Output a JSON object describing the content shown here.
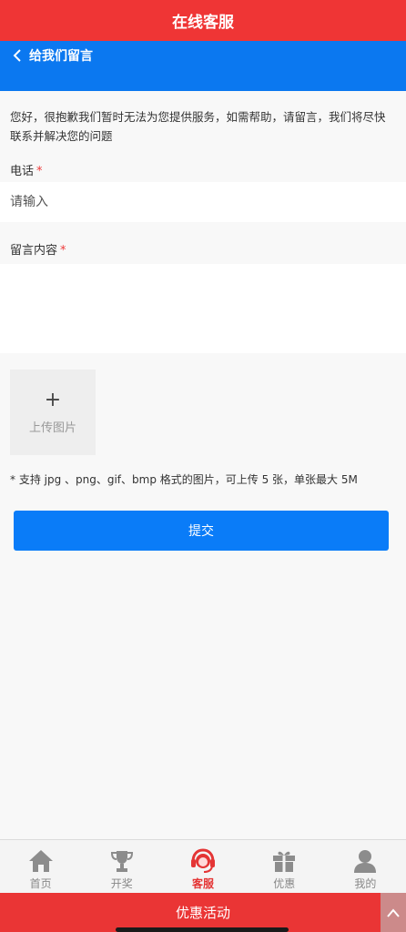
{
  "header": {
    "title": "在线客服"
  },
  "subheader": {
    "back_label": "给我们留言"
  },
  "form": {
    "intro": "您好，很抱歉我们暂时无法为您提供服务，如需帮助，请留言，我们将尽快联系并解决您的问题",
    "phone_label": "电话",
    "phone_placeholder": "请输入",
    "message_label": "留言内容",
    "required_mark": "*",
    "upload_plus": "+",
    "upload_label": "上传图片",
    "upload_hint": "* 支持 jpg 、png、gif、bmp 格式的图片，可上传 5 张，单张最大 5M",
    "submit_label": "提交"
  },
  "tabs": [
    {
      "label": "首页",
      "icon": "home-icon"
    },
    {
      "label": "开奖",
      "icon": "trophy-icon"
    },
    {
      "label": "客服",
      "icon": "customer-service-icon",
      "active": true
    },
    {
      "label": "优惠",
      "icon": "gift-icon"
    },
    {
      "label": "我的",
      "icon": "user-icon"
    }
  ],
  "promo": {
    "label": "优惠活动"
  },
  "colors": {
    "header_red": "#ef3535",
    "subheader_blue": "#0b78f0",
    "button_blue": "#0a7cf8",
    "active_tab": "#e43535",
    "required_red": "#ee3a3a"
  }
}
